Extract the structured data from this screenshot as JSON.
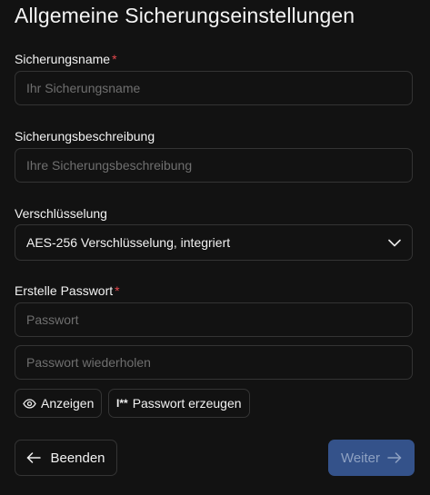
{
  "title": "Allgemeine Sicherungseinstellungen",
  "backup_name": {
    "label": "Sicherungsname",
    "required_mark": "*",
    "placeholder": "Ihr Sicherungsname",
    "value": ""
  },
  "backup_description": {
    "label": "Sicherungsbeschreibung",
    "placeholder": "Ihre Sicherungsbeschreibung",
    "value": ""
  },
  "encryption": {
    "label": "Verschlüsselung",
    "selected": "AES-256 Verschlüsselung, integriert"
  },
  "password": {
    "label": "Erstelle Passwort",
    "required_mark": "*",
    "placeholder": "Passwort",
    "repeat_placeholder": "Passwort wiederholen",
    "show_label": "Anzeigen",
    "generate_icon_text": "I**",
    "generate_label": "Passwort erzeugen"
  },
  "footer": {
    "back_label": "Beenden",
    "next_label": "Weiter"
  },
  "colors": {
    "background": "#121212",
    "border": "#343434",
    "required": "#e5484d",
    "primary_disabled": "#34528a"
  }
}
